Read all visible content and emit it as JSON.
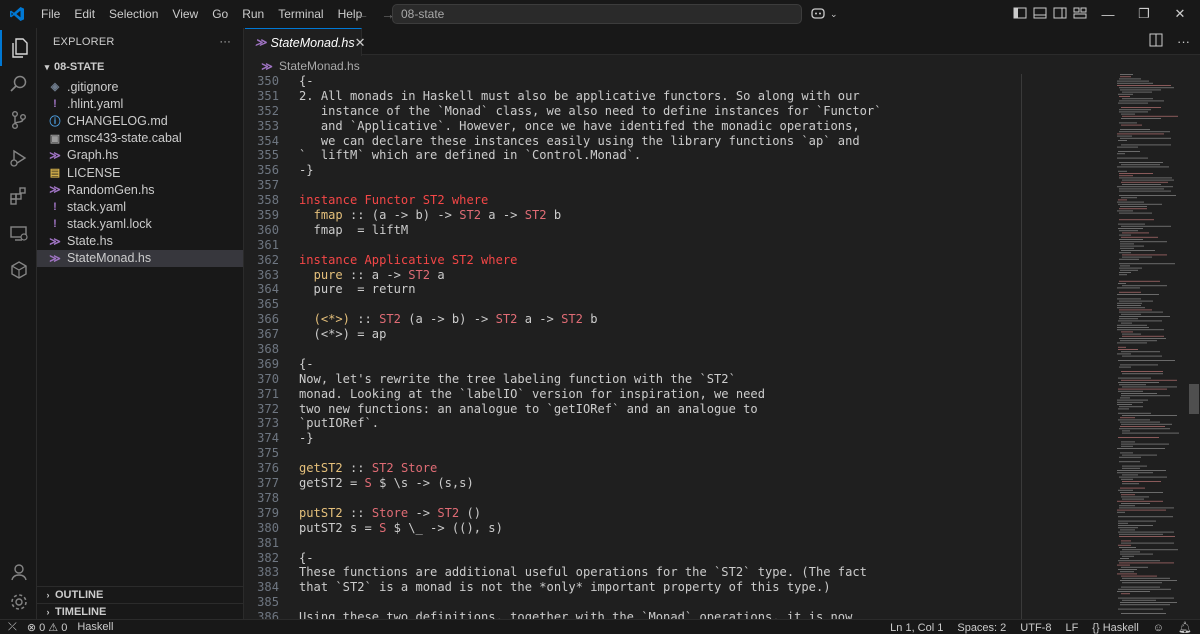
{
  "titlebar": {
    "menu": [
      "File",
      "Edit",
      "Selection",
      "View",
      "Go",
      "Run",
      "Terminal",
      "Help"
    ],
    "command_center": "08-state",
    "logo_color": "#0078d4"
  },
  "activitybar": {
    "items": [
      "files-icon",
      "search-icon",
      "source-control-icon",
      "run-debug-icon",
      "extensions-icon",
      "remote-explorer-icon",
      "containers-icon"
    ],
    "bottom": [
      "account-icon",
      "settings-gear-icon"
    ]
  },
  "sidebar": {
    "title": "EXPLORER",
    "more": "···",
    "folder": "08-STATE",
    "files": [
      {
        "name": ".gitignore",
        "icon": "git-icon"
      },
      {
        "name": ".hlint.yaml",
        "icon": "yaml-icon"
      },
      {
        "name": "CHANGELOG.md",
        "icon": "markdown-icon"
      },
      {
        "name": "cmsc433-state.cabal",
        "icon": "cabal-icon"
      },
      {
        "name": "Graph.hs",
        "icon": "haskell-icon"
      },
      {
        "name": "LICENSE",
        "icon": "license-icon"
      },
      {
        "name": "RandomGen.hs",
        "icon": "haskell-icon"
      },
      {
        "name": "stack.yaml",
        "icon": "yaml-icon"
      },
      {
        "name": "stack.yaml.lock",
        "icon": "yaml-icon"
      },
      {
        "name": "State.hs",
        "icon": "haskell-icon"
      },
      {
        "name": "StateMonad.hs",
        "icon": "haskell-icon",
        "selected": true
      }
    ],
    "outline": "OUTLINE",
    "timeline": "TIMELINE"
  },
  "editor": {
    "tab": "StateMonad.hs",
    "breadcrumb": "StateMonad.hs",
    "lines": [
      {
        "n": "350",
        "t": "{-"
      },
      {
        "n": "351",
        "t": "2. All monads in Haskell must also be applicative functors. So along with our"
      },
      {
        "n": "352",
        "t": "   instance of the `Monad` class, we also need to define instances for `Functor`"
      },
      {
        "n": "353",
        "t": "   and `Applicative`. However, once we have identifed the monadic operations,"
      },
      {
        "n": "354",
        "t": "   we can declare these instances easily using the library functions `ap` and"
      },
      {
        "n": "355",
        "t": "`  liftM` which are defined in `Control.Monad`."
      },
      {
        "n": "356",
        "t": "-}"
      },
      {
        "n": "357",
        "t": ""
      },
      {
        "n": "358",
        "t": "instance Functor ST2 where",
        "k": "inst"
      },
      {
        "n": "359",
        "t": "  fmap :: (a -> b) -> ST2 a -> ST2 b",
        "k": "sig"
      },
      {
        "n": "360",
        "t": "  fmap  = liftM"
      },
      {
        "n": "361",
        "t": ""
      },
      {
        "n": "362",
        "t": "instance Applicative ST2 where",
        "k": "inst"
      },
      {
        "n": "363",
        "t": "  pure :: a -> ST2 a",
        "k": "sig"
      },
      {
        "n": "364",
        "t": "  pure  = return"
      },
      {
        "n": "365",
        "t": ""
      },
      {
        "n": "366",
        "t": "  (<*>) :: ST2 (a -> b) -> ST2 a -> ST2 b",
        "k": "sig"
      },
      {
        "n": "367",
        "t": "  (<*>) = ap"
      },
      {
        "n": "368",
        "t": ""
      },
      {
        "n": "369",
        "t": "{-"
      },
      {
        "n": "370",
        "t": "Now, let's rewrite the tree labeling function with the `ST2`"
      },
      {
        "n": "371",
        "t": "monad. Looking at the `labelIO` version for inspiration, we need"
      },
      {
        "n": "372",
        "t": "two new functions: an analogue to `getIORef` and an analogue to"
      },
      {
        "n": "373",
        "t": "`putIORef`."
      },
      {
        "n": "374",
        "t": "-}"
      },
      {
        "n": "375",
        "t": ""
      },
      {
        "n": "376",
        "t": "getST2 :: ST2 Store",
        "k": "sig"
      },
      {
        "n": "377",
        "t": "getST2 = S $ \\s -> (s,s)",
        "k": "def"
      },
      {
        "n": "378",
        "t": ""
      },
      {
        "n": "379",
        "t": "putST2 :: Store -> ST2 ()",
        "k": "sig"
      },
      {
        "n": "380",
        "t": "putST2 s = S $ \\_ -> ((), s)",
        "k": "def"
      },
      {
        "n": "381",
        "t": ""
      },
      {
        "n": "382",
        "t": "{-"
      },
      {
        "n": "383",
        "t": "These functions are additional useful operations for the `ST2` type. (The fact"
      },
      {
        "n": "384",
        "t": "that `ST2` is a monad is not the *only* important property of this type.)"
      },
      {
        "n": "385",
        "t": ""
      },
      {
        "n": "386",
        "t": "Using these two definitions, together with the `Monad` operations, it is now"
      }
    ]
  },
  "statusbar": {
    "errors": "0",
    "warnings": "0",
    "language_left": "Haskell",
    "position": "Ln 1, Col 1",
    "spaces": "Spaces: 2",
    "encoding": "UTF-8",
    "eol": "LF",
    "language": "Haskell"
  }
}
